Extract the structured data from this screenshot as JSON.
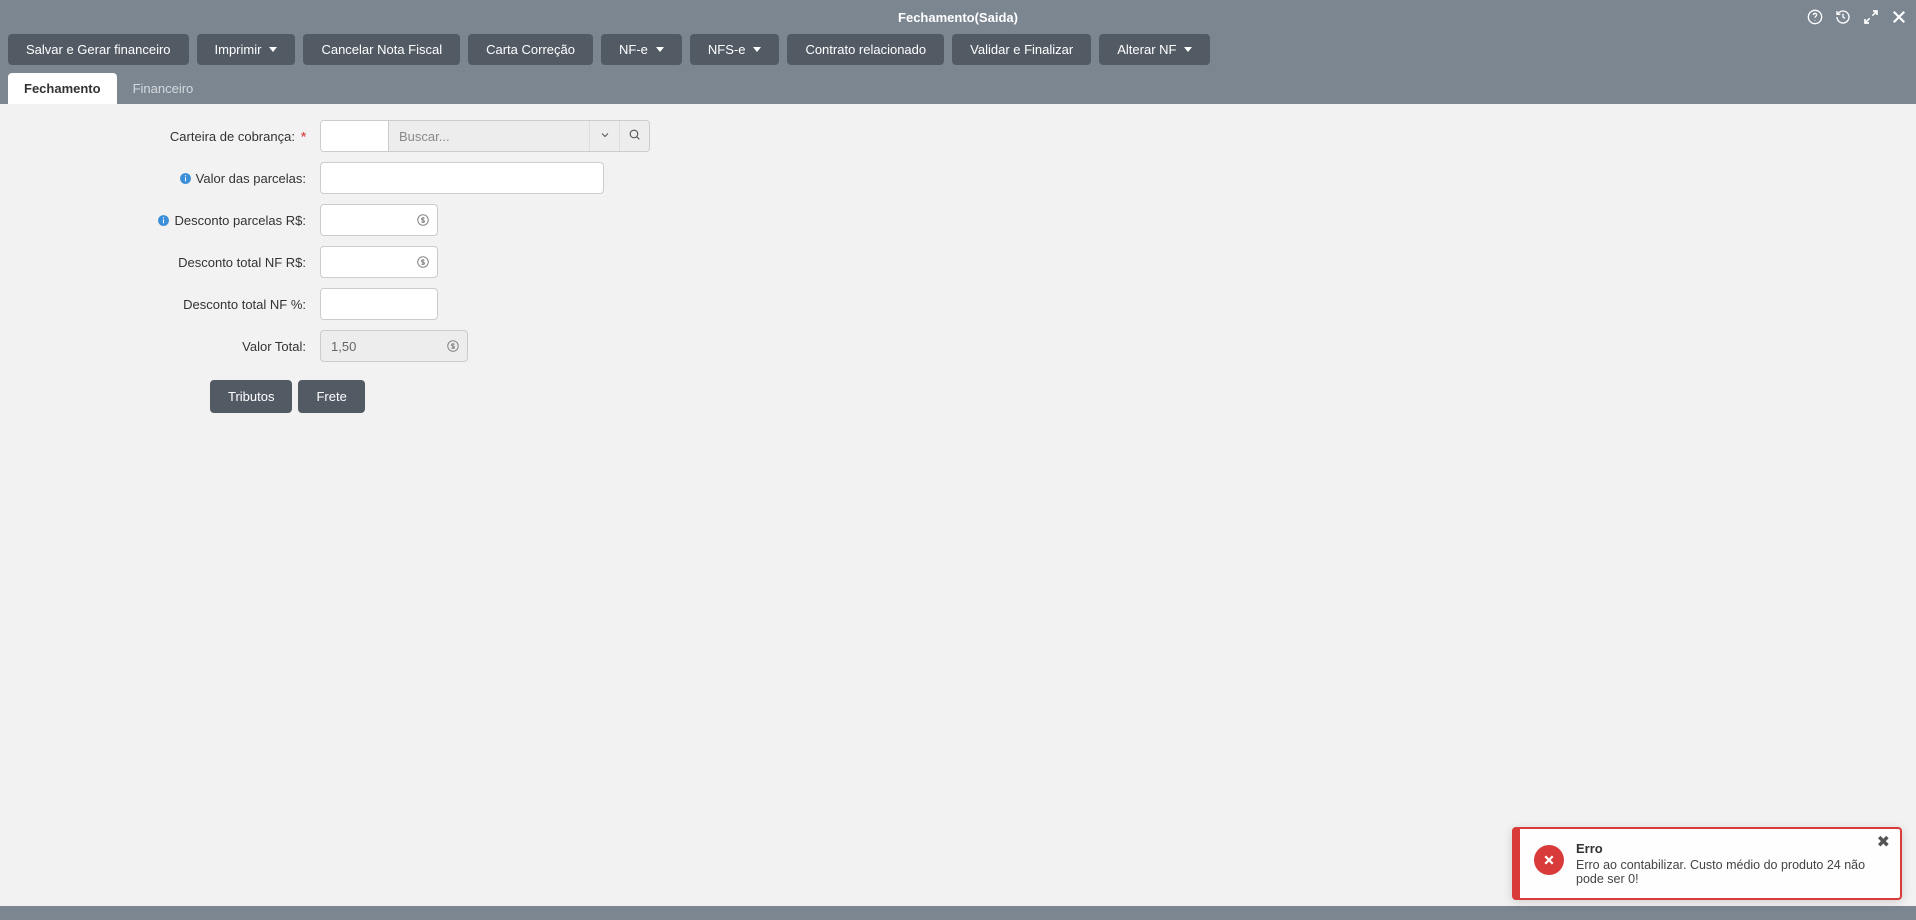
{
  "header": {
    "title": "Fechamento(Saida)"
  },
  "toolbar": {
    "salvar_gerar": "Salvar e Gerar financeiro",
    "imprimir": "Imprimir",
    "cancelar_nf": "Cancelar Nota Fiscal",
    "carta_correcao": "Carta Correção",
    "nfe": "NF-e",
    "nfse": "NFS-e",
    "contrato_relacionado": "Contrato relacionado",
    "validar_finalizar": "Validar e Finalizar",
    "alterar_nf": "Alterar NF"
  },
  "tabs": {
    "fechamento": "Fechamento",
    "financeiro": "Financeiro"
  },
  "form": {
    "carteira_label": "Carteira de cobrança:",
    "carteira_code": "",
    "carteira_search_placeholder": "Buscar...",
    "valor_parcelas_label": "Valor das parcelas:",
    "valor_parcelas_value": "",
    "desconto_parcelas_label": "Desconto parcelas R$:",
    "desconto_parcelas_value": "",
    "desconto_total_nf_rs_label": "Desconto total NF R$:",
    "desconto_total_nf_rs_value": "",
    "desconto_total_nf_pct_label": "Desconto total NF %:",
    "desconto_total_nf_pct_value": "",
    "valor_total_label": "Valor Total:",
    "valor_total_value": "1,50"
  },
  "sub_buttons": {
    "tributos": "Tributos",
    "frete": "Frete"
  },
  "toast": {
    "title": "Erro",
    "message": "Erro ao contabilizar. Custo médio do produto 24 não pode ser 0!"
  }
}
